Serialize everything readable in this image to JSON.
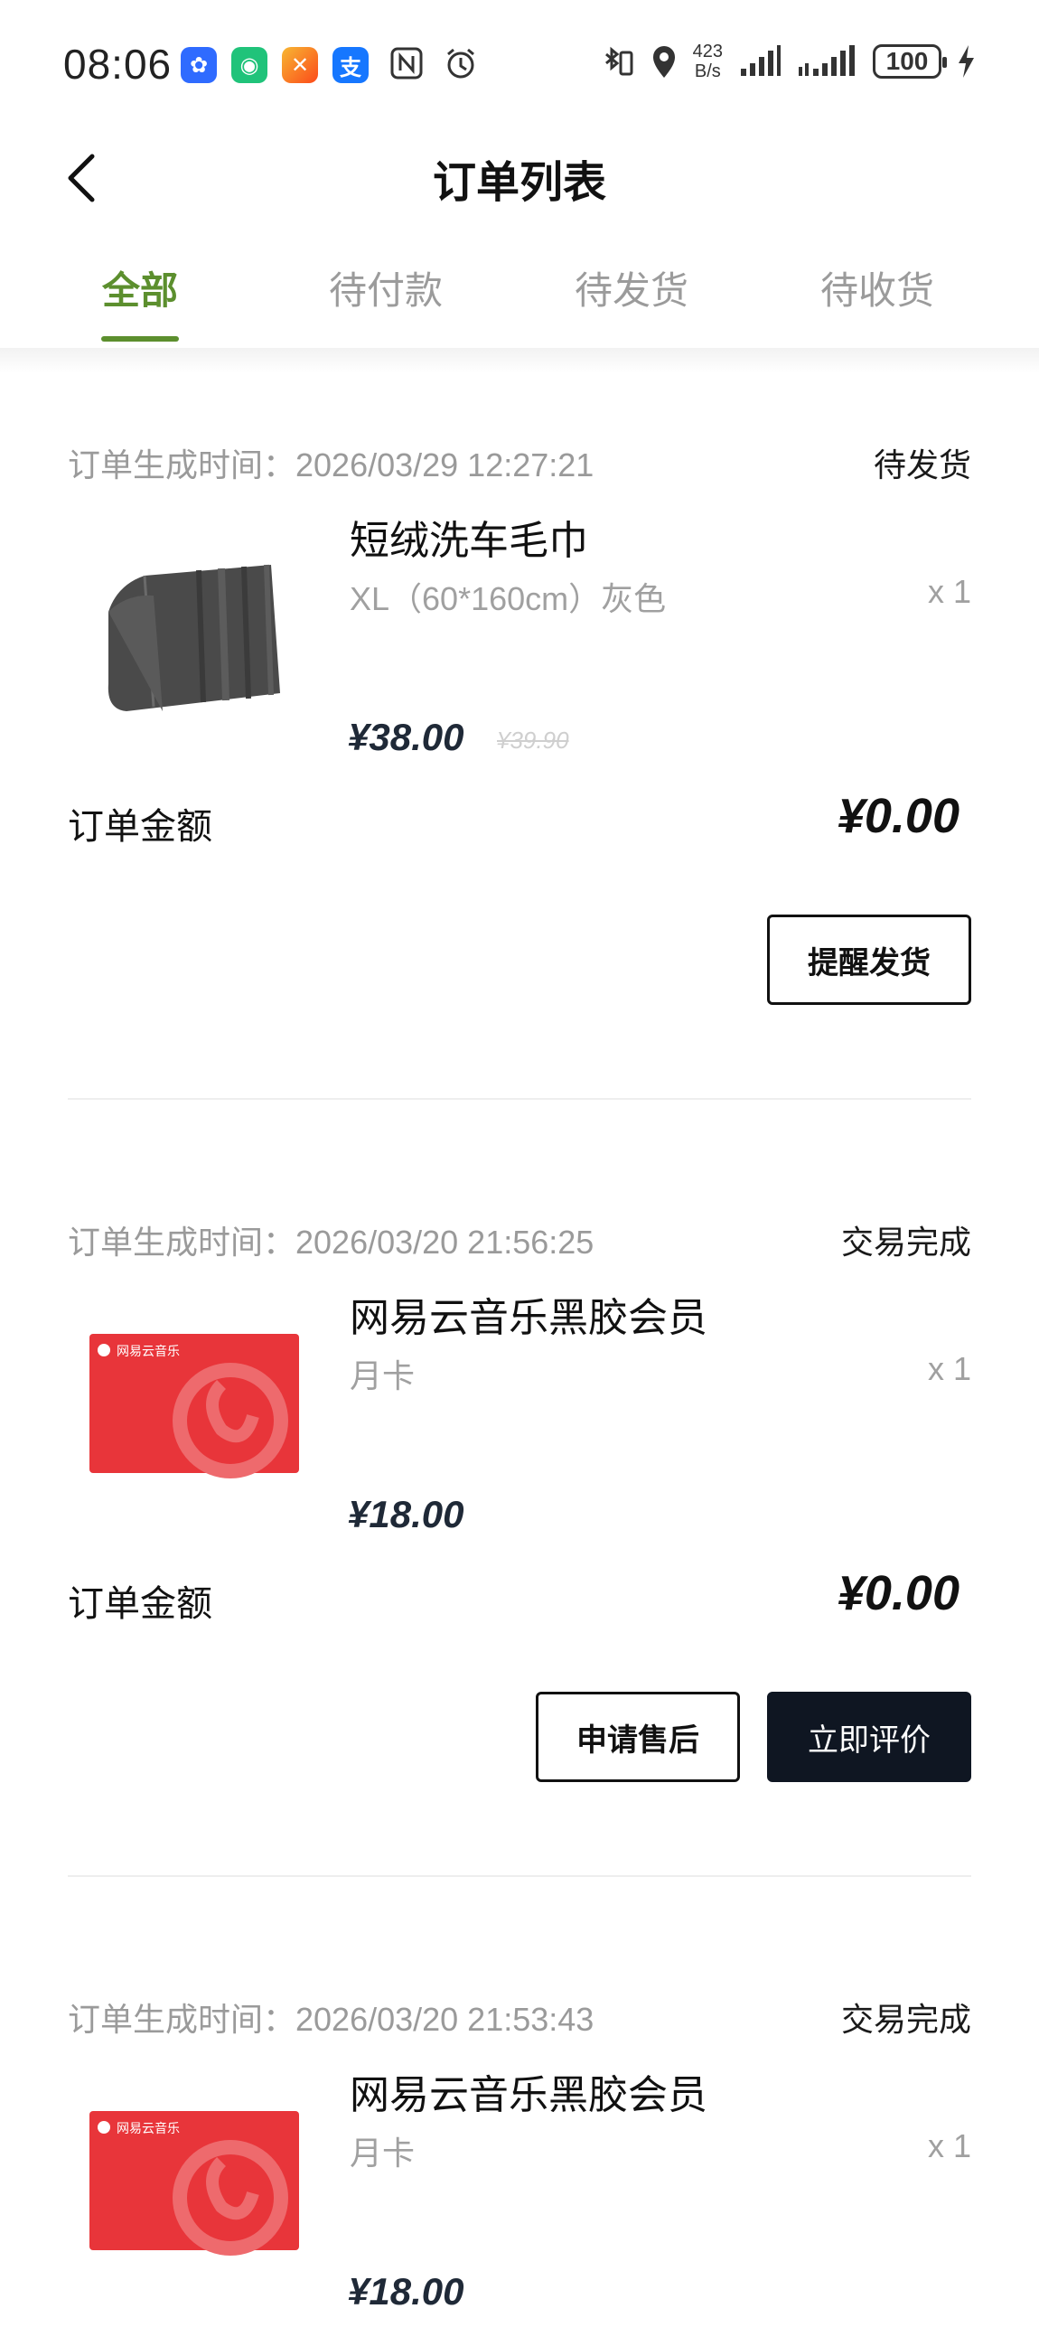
{
  "status_bar": {
    "time": "08:06",
    "net_speed_value": "423",
    "net_speed_unit": "B/s",
    "battery": "100",
    "app_icons": [
      "tencent-icon",
      "wechat-green-icon",
      "game-icon",
      "alipay-icon"
    ],
    "app_glyphs": [
      "✿",
      "◉",
      "✕",
      "支"
    ]
  },
  "header": {
    "title": "订单列表"
  },
  "tabs": [
    {
      "label": "全部"
    },
    {
      "label": "待付款"
    },
    {
      "label": "待发货"
    },
    {
      "label": "待收货"
    }
  ],
  "orders": [
    {
      "time_label": "订单生成时间：2026/03/29 12:27:21",
      "status": "待发货",
      "product_name": "短绒洗车毛巾",
      "spec": "XL（60*160cm）灰色",
      "qty": "x 1",
      "price": "¥38.00",
      "original_price": "¥39.90",
      "total_label": "订单金额",
      "total": "¥0.00",
      "buttons": [
        "提醒发货"
      ]
    },
    {
      "time_label": "订单生成时间：2026/03/20 21:56:25",
      "status": "交易完成",
      "product_name": "网易云音乐黑胶会员",
      "spec": "月卡",
      "qty": "x 1",
      "price": "¥18.00",
      "total_label": "订单金额",
      "total": "¥0.00",
      "buttons": [
        "申请售后",
        "立即评价"
      ],
      "card_brand": "网易云音乐"
    },
    {
      "time_label": "订单生成时间：2026/03/20 21:53:43",
      "status": "交易完成",
      "product_name": "网易云音乐黑胶会员",
      "spec": "月卡",
      "qty": "x 1",
      "price": "¥18.00",
      "card_brand": "网易云音乐"
    }
  ],
  "colors": {
    "accent": "#5c8f2e",
    "dark_button": "#0f1622",
    "card_red": "#e8353a"
  }
}
